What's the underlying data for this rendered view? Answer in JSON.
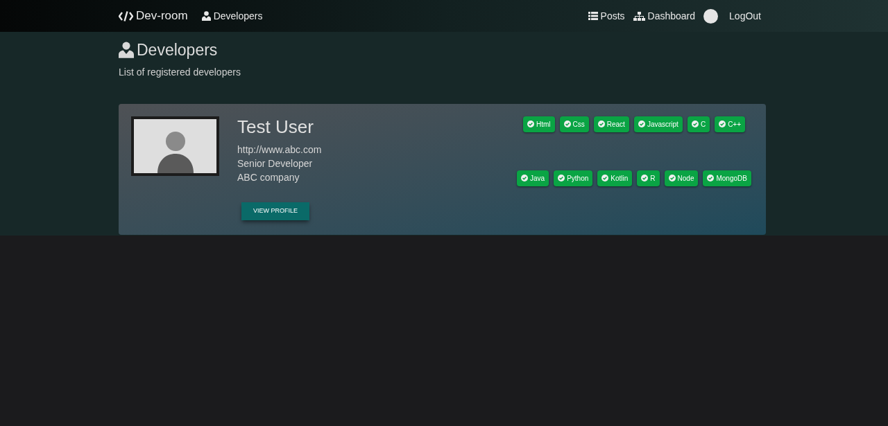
{
  "navbar": {
    "brand": "Dev-room",
    "links": [
      {
        "label": "Developers",
        "kind": "user"
      }
    ],
    "right_links": [
      {
        "label": "Posts",
        "kind": "list"
      },
      {
        "label": "Dashboard",
        "kind": "sitemap"
      },
      {
        "label": "LogOut",
        "kind": "avatar"
      }
    ]
  },
  "header": {
    "title": "Developers",
    "subtitle": "List of registered developers"
  },
  "developers": [
    {
      "name": "Test User",
      "website": "http://www.abc.com",
      "status": "Senior Developer",
      "company": "ABC company",
      "button": "VIEW PROFILE",
      "skill_rows": [
        [
          "Html",
          "Css",
          "React",
          "Javascript",
          "C",
          "C++"
        ],
        [
          "Java",
          "Python",
          "Kotlin",
          "R",
          "Node",
          "MongoDB"
        ]
      ]
    }
  ]
}
